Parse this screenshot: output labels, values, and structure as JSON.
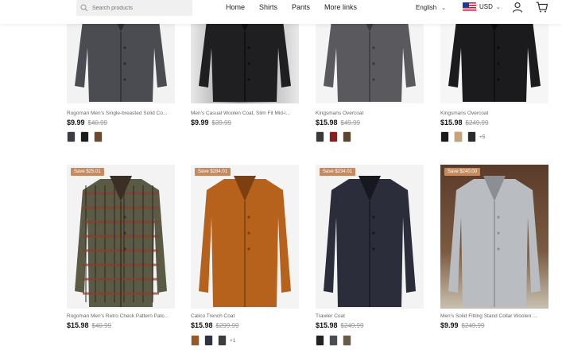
{
  "header": {
    "search_placeholder": "Search products",
    "nav": [
      "Home",
      "Shirts",
      "Pants",
      "More links"
    ],
    "language": "English",
    "currency": "USD"
  },
  "products": [
    {
      "title": "Rogoman Men's Single-breasted Solid Co...",
      "price": "$9.99",
      "old_price": "$40.99",
      "badge": "",
      "swatches": [
        "#3a3d44",
        "#1c1c1c",
        "#6b4a2c"
      ],
      "more": ""
    },
    {
      "title": "Men's Casual Woolen Coat, Slim Fit Mid-l...",
      "price": "$9.99",
      "old_price": "$39.99",
      "badge": "",
      "swatches": [],
      "more": ""
    },
    {
      "title": "Kingsmans Overcoat",
      "price": "$15.98",
      "old_price": "$49.99",
      "badge": "",
      "swatches": [
        "#3b3b3b",
        "#8b1d1d",
        "#5d4630"
      ],
      "more": ""
    },
    {
      "title": "Kingsmans Overcoat",
      "price": "$15.98",
      "old_price": "$249.99",
      "badge": "",
      "swatches": [
        "#1a1a1a",
        "#c8a27c",
        "#2b2b2b"
      ],
      "more": "+5"
    },
    {
      "title": "Rogoman Men's Retro Check Pattern Patc...",
      "price": "$15.98",
      "old_price": "$40.99",
      "badge": "Save $25.01",
      "swatches": [],
      "more": ""
    },
    {
      "title": "Calico Trench Coat",
      "price": "$15.98",
      "old_price": "$299.99",
      "badge": "Save $284.01",
      "swatches": [
        "#9a5a1f",
        "#2f3140",
        "#3d3d3d"
      ],
      "more": "+1"
    },
    {
      "title": "Trawler Coat",
      "price": "$15.98",
      "old_price": "$249.99",
      "badge": "Save $234.01",
      "swatches": [
        "#222222",
        "#4a4c56",
        "#6a5a48"
      ],
      "more": ""
    },
    {
      "title": "Men's Solid Fitting Stand Collar Woolen ...",
      "price": "$9.99",
      "old_price": "$249.99",
      "badge": "Save $240.00",
      "swatches": [],
      "more": ""
    }
  ]
}
